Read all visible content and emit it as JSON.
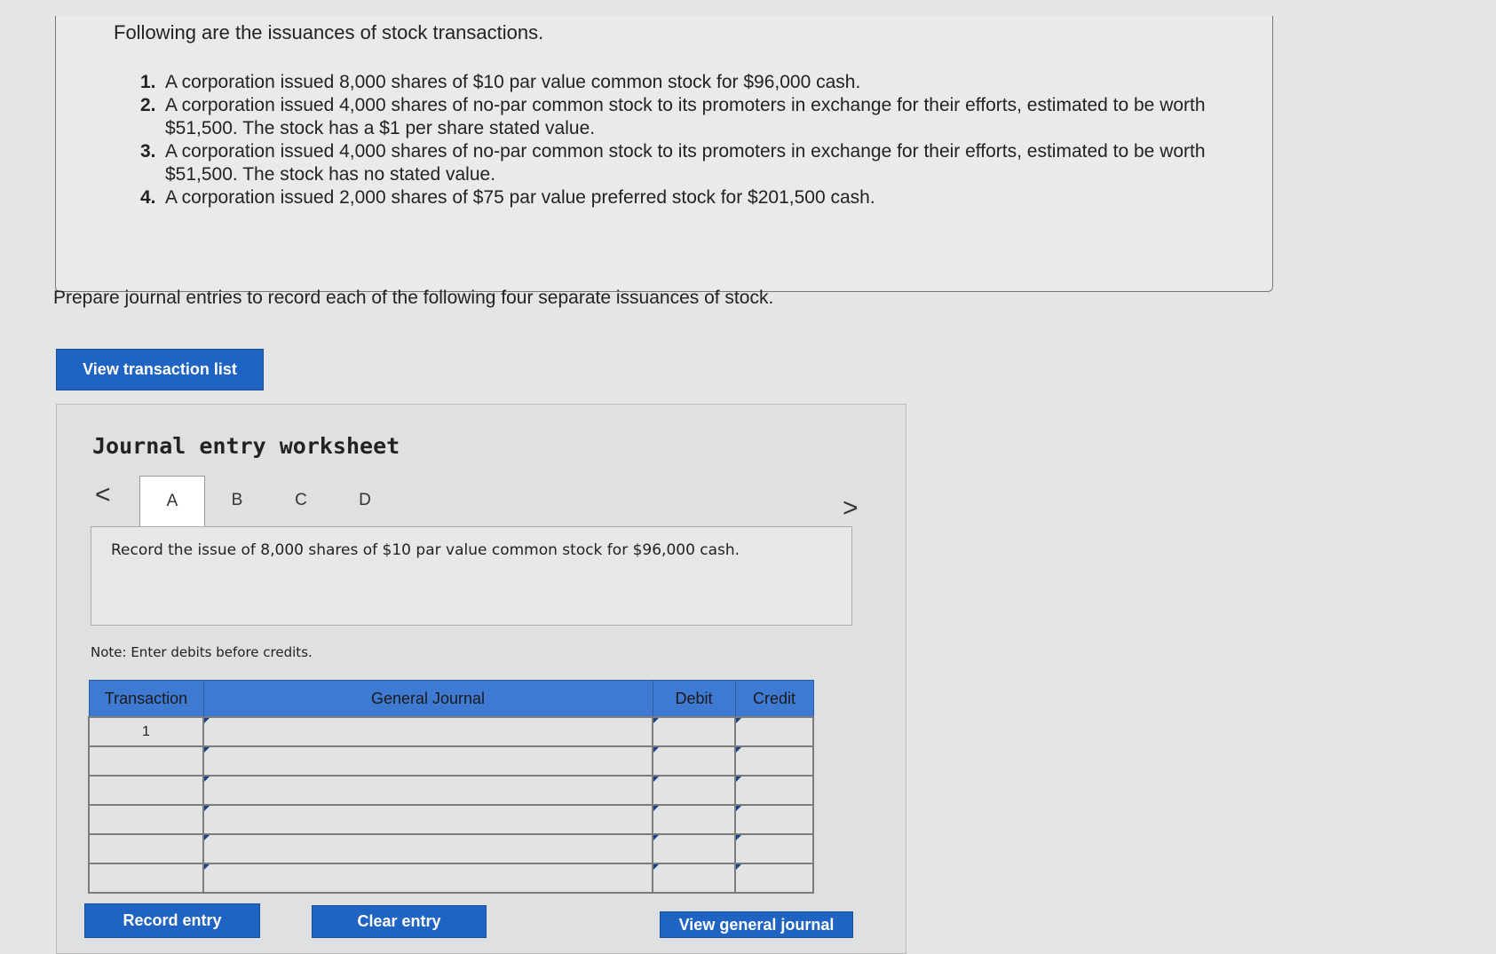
{
  "problem": {
    "intro": "Following are the issuances of stock transactions.",
    "items": [
      {
        "num": "1.",
        "text": "A corporation issued 8,000 shares of $10 par value common stock for $96,000 cash."
      },
      {
        "num": "2.",
        "text": "A corporation issued 4,000 shares of no-par common stock to its promoters in exchange for their efforts, estimated to be worth $51,500. The stock has a $1 per share stated value."
      },
      {
        "num": "3.",
        "text": "A corporation issued 4,000 shares of no-par common stock to its promoters in exchange for their efforts, estimated to be worth $51,500. The stock has no stated value."
      },
      {
        "num": "4.",
        "text": "A corporation issued 2,000 shares of $75 par value preferred stock for $201,500 cash."
      }
    ]
  },
  "instruction": "Prepare journal entries to record each of the following four separate issuances of stock.",
  "view_transaction_list_label": "View transaction list",
  "worksheet": {
    "title": "Journal entry worksheet",
    "prev_glyph": "<",
    "next_glyph": ">",
    "tabs": [
      "A",
      "B",
      "C",
      "D"
    ],
    "description": "Record the issue of 8,000 shares of $10 par value common stock for $96,000 cash.",
    "note": "Note: Enter debits before credits.",
    "table": {
      "headers": {
        "transaction": "Transaction",
        "general_journal": "General Journal",
        "debit": "Debit",
        "credit": "Credit"
      },
      "rows": [
        {
          "transaction": "1"
        },
        {
          "transaction": ""
        },
        {
          "transaction": ""
        },
        {
          "transaction": ""
        },
        {
          "transaction": ""
        },
        {
          "transaction": ""
        }
      ]
    }
  },
  "buttons": {
    "record_entry": "Record entry",
    "clear_entry": "Clear entry",
    "view_general_journal": "View general journal"
  }
}
